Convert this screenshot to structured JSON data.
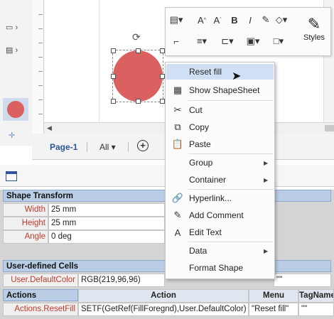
{
  "page_tabs": {
    "active": "Page-1",
    "all": "All ▾",
    "add": "+"
  },
  "context_menu": [
    {
      "icon": "reset-icon",
      "label": "Reset fill",
      "submenu": false,
      "hover": true
    },
    {
      "icon": "shapesheet-icon",
      "label": "Show ShapeSheet",
      "submenu": false
    },
    {
      "icon": "cut-icon",
      "label": "Cut",
      "submenu": false
    },
    {
      "icon": "copy-icon",
      "label": "Copy",
      "submenu": false
    },
    {
      "icon": "paste-icon",
      "label": "Paste",
      "submenu": false
    },
    {
      "icon": "",
      "label": "Group",
      "submenu": true
    },
    {
      "icon": "",
      "label": "Container",
      "submenu": true
    },
    {
      "icon": "hyperlink-icon",
      "label": "Hyperlink...",
      "submenu": false
    },
    {
      "icon": "comment-icon",
      "label": "Add Comment",
      "submenu": false
    },
    {
      "icon": "text-icon",
      "label": "Edit Text",
      "submenu": false
    },
    {
      "icon": "",
      "label": "Data",
      "submenu": true
    },
    {
      "icon": "",
      "label": "Format Shape",
      "submenu": false
    }
  ],
  "mini_toolbar": {
    "styles_label": "Styles"
  },
  "shapesheet": {
    "shape_transform": {
      "title": "Shape Transform",
      "rows": [
        {
          "name": "Width",
          "value": "25 mm"
        },
        {
          "name": "Height",
          "value": "25 mm"
        },
        {
          "name": "Angle",
          "value": "0 deg"
        }
      ]
    },
    "user_defined": {
      "title": "User-defined Cells",
      "rows": [
        {
          "name": "User.DefaultColor",
          "value": "RGB(219,96,96)",
          "extra": "\"\""
        }
      ]
    },
    "actions": {
      "title": "Actions",
      "headers": [
        "Action",
        "Menu",
        "TagName"
      ],
      "rows": [
        {
          "name": "Actions.ResetFill",
          "action": "SETF(GetRef(FillForegnd),User.DefaultColor)",
          "menu": "\"Reset fill\"",
          "tag": "\"\""
        }
      ]
    }
  },
  "colors": {
    "shape_fill": "#db6060",
    "accent": "#2b579a",
    "section_header": "#b9cde5"
  }
}
